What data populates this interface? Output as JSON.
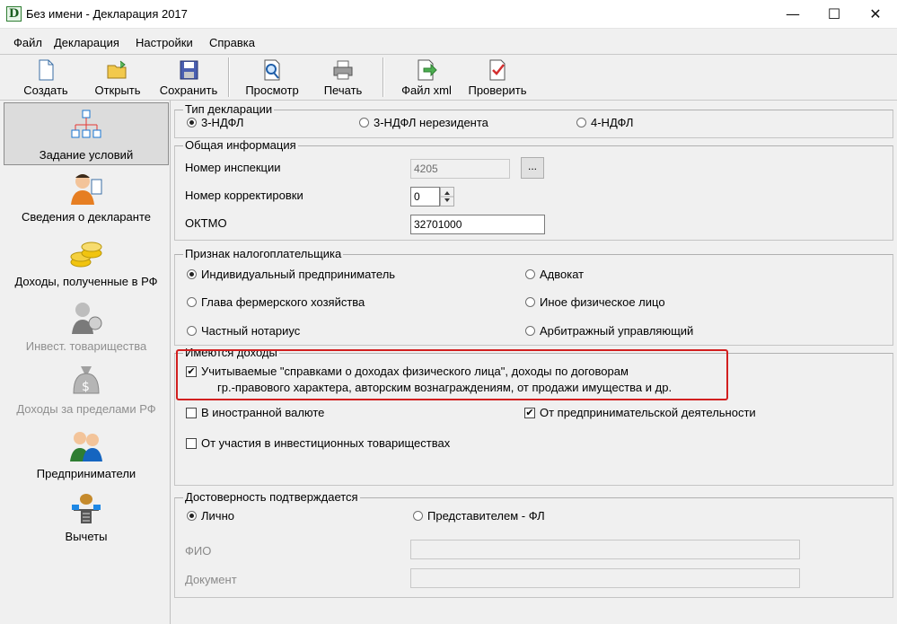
{
  "window": {
    "title": "Без имени - Декларация 2017",
    "app_icon": "D",
    "minimize": "—",
    "maximize": "☐",
    "close": "✕"
  },
  "menu": [
    "Файл",
    "Декларация",
    "Настройки",
    "Справка"
  ],
  "toolbar": {
    "create": "Создать",
    "open": "Открыть",
    "save": "Сохранить",
    "preview": "Просмотр",
    "print": "Печать",
    "xml": "Файл xml",
    "check": "Проверить"
  },
  "nav": [
    "Задание условий",
    "Сведения о декларанте",
    "Доходы, полученные в РФ",
    "Инвест. товарищества",
    "Доходы за пределами РФ",
    "Предприниматели",
    "Вычеты"
  ],
  "decl_type": {
    "title": "Тип декларации",
    "options": [
      "3-НДФЛ",
      "3-НДФЛ нерезидента",
      "4-НДФЛ"
    ],
    "selected": "3-НДФЛ"
  },
  "general": {
    "title": "Общая информация",
    "inspection_label": "Номер инспекции",
    "inspection_value": "4205",
    "browse": "...",
    "correction_label": "Номер корректировки",
    "correction_value": "0",
    "oktmo_label": "ОКТМО",
    "oktmo_value": "32701000"
  },
  "taxpayer": {
    "title": "Признак налогоплательщика",
    "options": [
      "Индивидуальный предприниматель",
      "Адвокат",
      "Глава фермерского хозяйства",
      "Иное физическое лицо",
      "Частный нотариус",
      "Арбитражный управляющий"
    ],
    "selected": "Индивидуальный предприниматель"
  },
  "income": {
    "title": "Имеются доходы",
    "item1_line1": "Учитываемые \"справками о доходах физического лица\", доходы по договорам",
    "item1_line2": "гр.-правового характера, авторским вознаграждениям, от продажи имущества и др.",
    "item1_checked": true,
    "foreign": "В иностранной валюте",
    "foreign_checked": false,
    "business": "От предпринимательской деятельности",
    "business_checked": true,
    "invest": "От участия в инвестиционных товариществах",
    "invest_checked": false,
    "highlight_color": "#d21f1f"
  },
  "auth": {
    "title": "Достоверность подтверждается",
    "personal": "Лично",
    "rep": "Представителем - ФЛ",
    "selected": "Лично",
    "fio": "ФИО",
    "doc": "Документ"
  }
}
